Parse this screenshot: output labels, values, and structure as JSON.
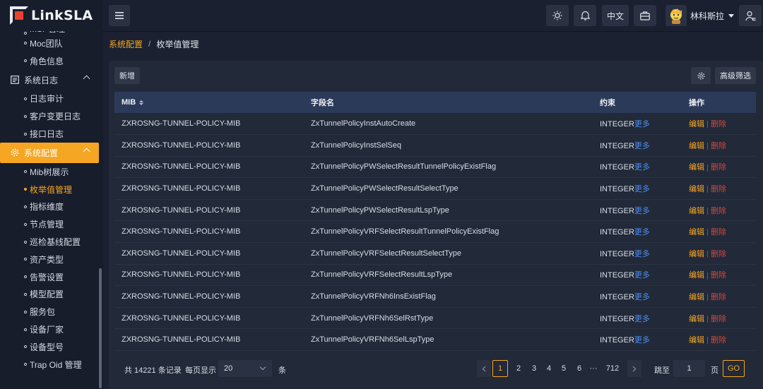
{
  "app": {
    "logo_text": "LinkSLA"
  },
  "sidebar": {
    "partial_top": "MSP管理",
    "items": [
      {
        "type": "sub",
        "label": "Moc团队"
      },
      {
        "type": "sub",
        "label": "角色信息"
      },
      {
        "type": "group",
        "label": "系统日志",
        "icon": "log-icon"
      },
      {
        "type": "sub",
        "label": "日志审计"
      },
      {
        "type": "sub",
        "label": "客户变更日志"
      },
      {
        "type": "sub",
        "label": "接口日志"
      },
      {
        "type": "group",
        "label": "系统配置",
        "icon": "gear-icon",
        "active": true
      },
      {
        "type": "sub",
        "label": "Mib树展示"
      },
      {
        "type": "sub",
        "label": "枚举值管理",
        "active": true
      },
      {
        "type": "sub",
        "label": "指标维度"
      },
      {
        "type": "sub",
        "label": "节点管理"
      },
      {
        "type": "sub",
        "label": "巡检基线配置"
      },
      {
        "type": "sub",
        "label": "资产类型"
      },
      {
        "type": "sub",
        "label": "告警设置"
      },
      {
        "type": "sub",
        "label": "模型配置"
      },
      {
        "type": "sub",
        "label": "服务包"
      },
      {
        "type": "sub",
        "label": "设备厂家"
      },
      {
        "type": "sub",
        "label": "设备型号"
      },
      {
        "type": "sub",
        "label": "Trap Oid 管理"
      }
    ]
  },
  "topbar": {
    "lang_label": "中文",
    "username": "林科斯拉"
  },
  "breadcrumb": {
    "parent": "系统配置",
    "separator": "/",
    "current": "枚举值管理"
  },
  "toolbar": {
    "add_label": "新增",
    "filter_label": "高级筛选"
  },
  "table": {
    "headers": {
      "mib": "MIB",
      "field": "字段名",
      "constraint": "约束",
      "ops": "操作"
    },
    "more_label": "更多",
    "edit_label": "编辑",
    "delete_label": "删除",
    "rows": [
      {
        "mib": "ZXROSNG-TUNNEL-POLICY-MIB",
        "field": "ZxTunnelPolicyInstAutoCreate",
        "constraint": "INTEGER"
      },
      {
        "mib": "ZXROSNG-TUNNEL-POLICY-MIB",
        "field": "ZxTunnelPolicyInstSelSeq",
        "constraint": "INTEGER"
      },
      {
        "mib": "ZXROSNG-TUNNEL-POLICY-MIB",
        "field": "ZxTunnelPolicyPWSelectResultTunnelPolicyExistFlag",
        "constraint": "INTEGER"
      },
      {
        "mib": "ZXROSNG-TUNNEL-POLICY-MIB",
        "field": "ZxTunnelPolicyPWSelectResultSelectType",
        "constraint": "INTEGER"
      },
      {
        "mib": "ZXROSNG-TUNNEL-POLICY-MIB",
        "field": "ZxTunnelPolicyPWSelectResultLspType",
        "constraint": "INTEGER"
      },
      {
        "mib": "ZXROSNG-TUNNEL-POLICY-MIB",
        "field": "ZxTunnelPolicyVRFSelectResultTunnelPolicyExistFlag",
        "constraint": "INTEGER"
      },
      {
        "mib": "ZXROSNG-TUNNEL-POLICY-MIB",
        "field": "ZxTunnelPolicyVRFSelectResultSelectType",
        "constraint": "INTEGER"
      },
      {
        "mib": "ZXROSNG-TUNNEL-POLICY-MIB",
        "field": "ZxTunnelPolicyVRFSelectResultLspType",
        "constraint": "INTEGER"
      },
      {
        "mib": "ZXROSNG-TUNNEL-POLICY-MIB",
        "field": "ZxTunnelPolicyVRFNh6InsExistFlag",
        "constraint": "INTEGER"
      },
      {
        "mib": "ZXROSNG-TUNNEL-POLICY-MIB",
        "field": "ZxTunnelPolicyVRFNh6SelRstType",
        "constraint": "INTEGER"
      },
      {
        "mib": "ZXROSNG-TUNNEL-POLICY-MIB",
        "field": "ZxTunnelPolicyVRFNh6SelLspType",
        "constraint": "INTEGER"
      }
    ]
  },
  "pagination": {
    "total_text": "共 14221 条记录",
    "page_size_label": "每页显示",
    "page_size": "20",
    "unit_label": "条",
    "pages": [
      "1",
      "2",
      "3",
      "4",
      "5",
      "6",
      "···",
      "712"
    ],
    "current_page": "1",
    "jump_label": "跳至",
    "jump_value": "1",
    "page_unit": "页",
    "go_label": "GO"
  },
  "colors": {
    "accent": "#f5a623",
    "link": "#4a8ff0",
    "danger": "#d2483f",
    "header_bg": "#2c3a5a"
  }
}
